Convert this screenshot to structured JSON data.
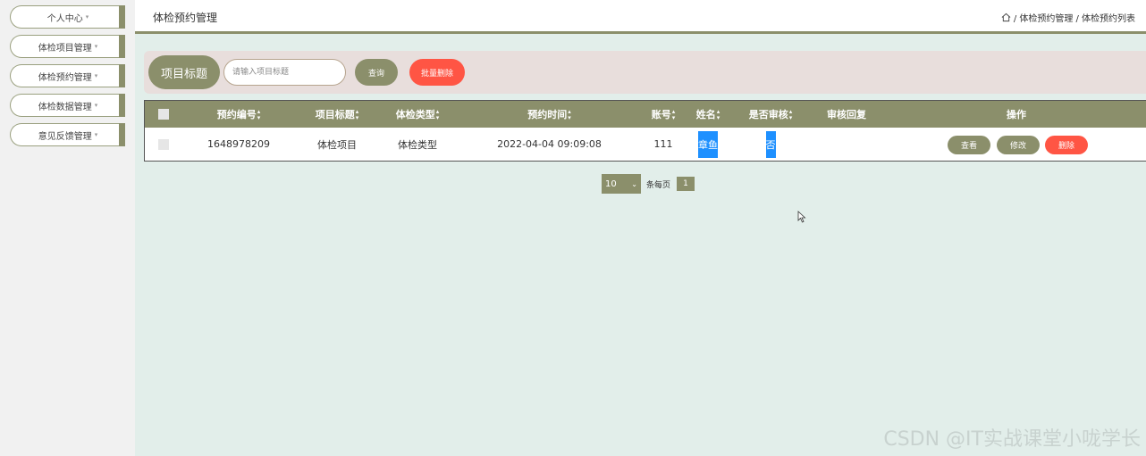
{
  "sidebar": {
    "items": [
      {
        "label": "个人中心"
      },
      {
        "label": "体检项目管理"
      },
      {
        "label": "体检预约管理"
      },
      {
        "label": "体检数据管理"
      },
      {
        "label": "意见反馈管理"
      }
    ]
  },
  "header": {
    "title": "体检预约管理",
    "breadcrumb": [
      "/ 体检预约管理",
      "/ 体检预约列表"
    ]
  },
  "search": {
    "label": "项目标题",
    "placeholder": "请输入项目标题",
    "query_button": "查询",
    "batch_delete_button": "批量删除"
  },
  "table": {
    "columns": [
      "预约编号",
      "项目标题",
      "体检类型",
      "预约时间",
      "账号",
      "姓名",
      "是否审核",
      "审核回复",
      "操作"
    ],
    "rows": [
      {
        "id": "1648978209",
        "project_title": "体检项目",
        "exam_type": "体检类型",
        "time": "2022-04-04 09:09:08",
        "account": "111",
        "name": "章鱼",
        "reviewed": "否",
        "review_reply": ""
      }
    ],
    "actions": {
      "view": "查看",
      "edit": "修改",
      "delete": "删除"
    }
  },
  "pagination": {
    "page_size": "10",
    "per_page_label": "条每页",
    "current_page": "1"
  },
  "watermark": "CSDN @IT实战课堂小咙学长",
  "colors": {
    "accent": "#8b8f6b",
    "danger": "#ff5544",
    "highlight": "#1e90ff"
  }
}
